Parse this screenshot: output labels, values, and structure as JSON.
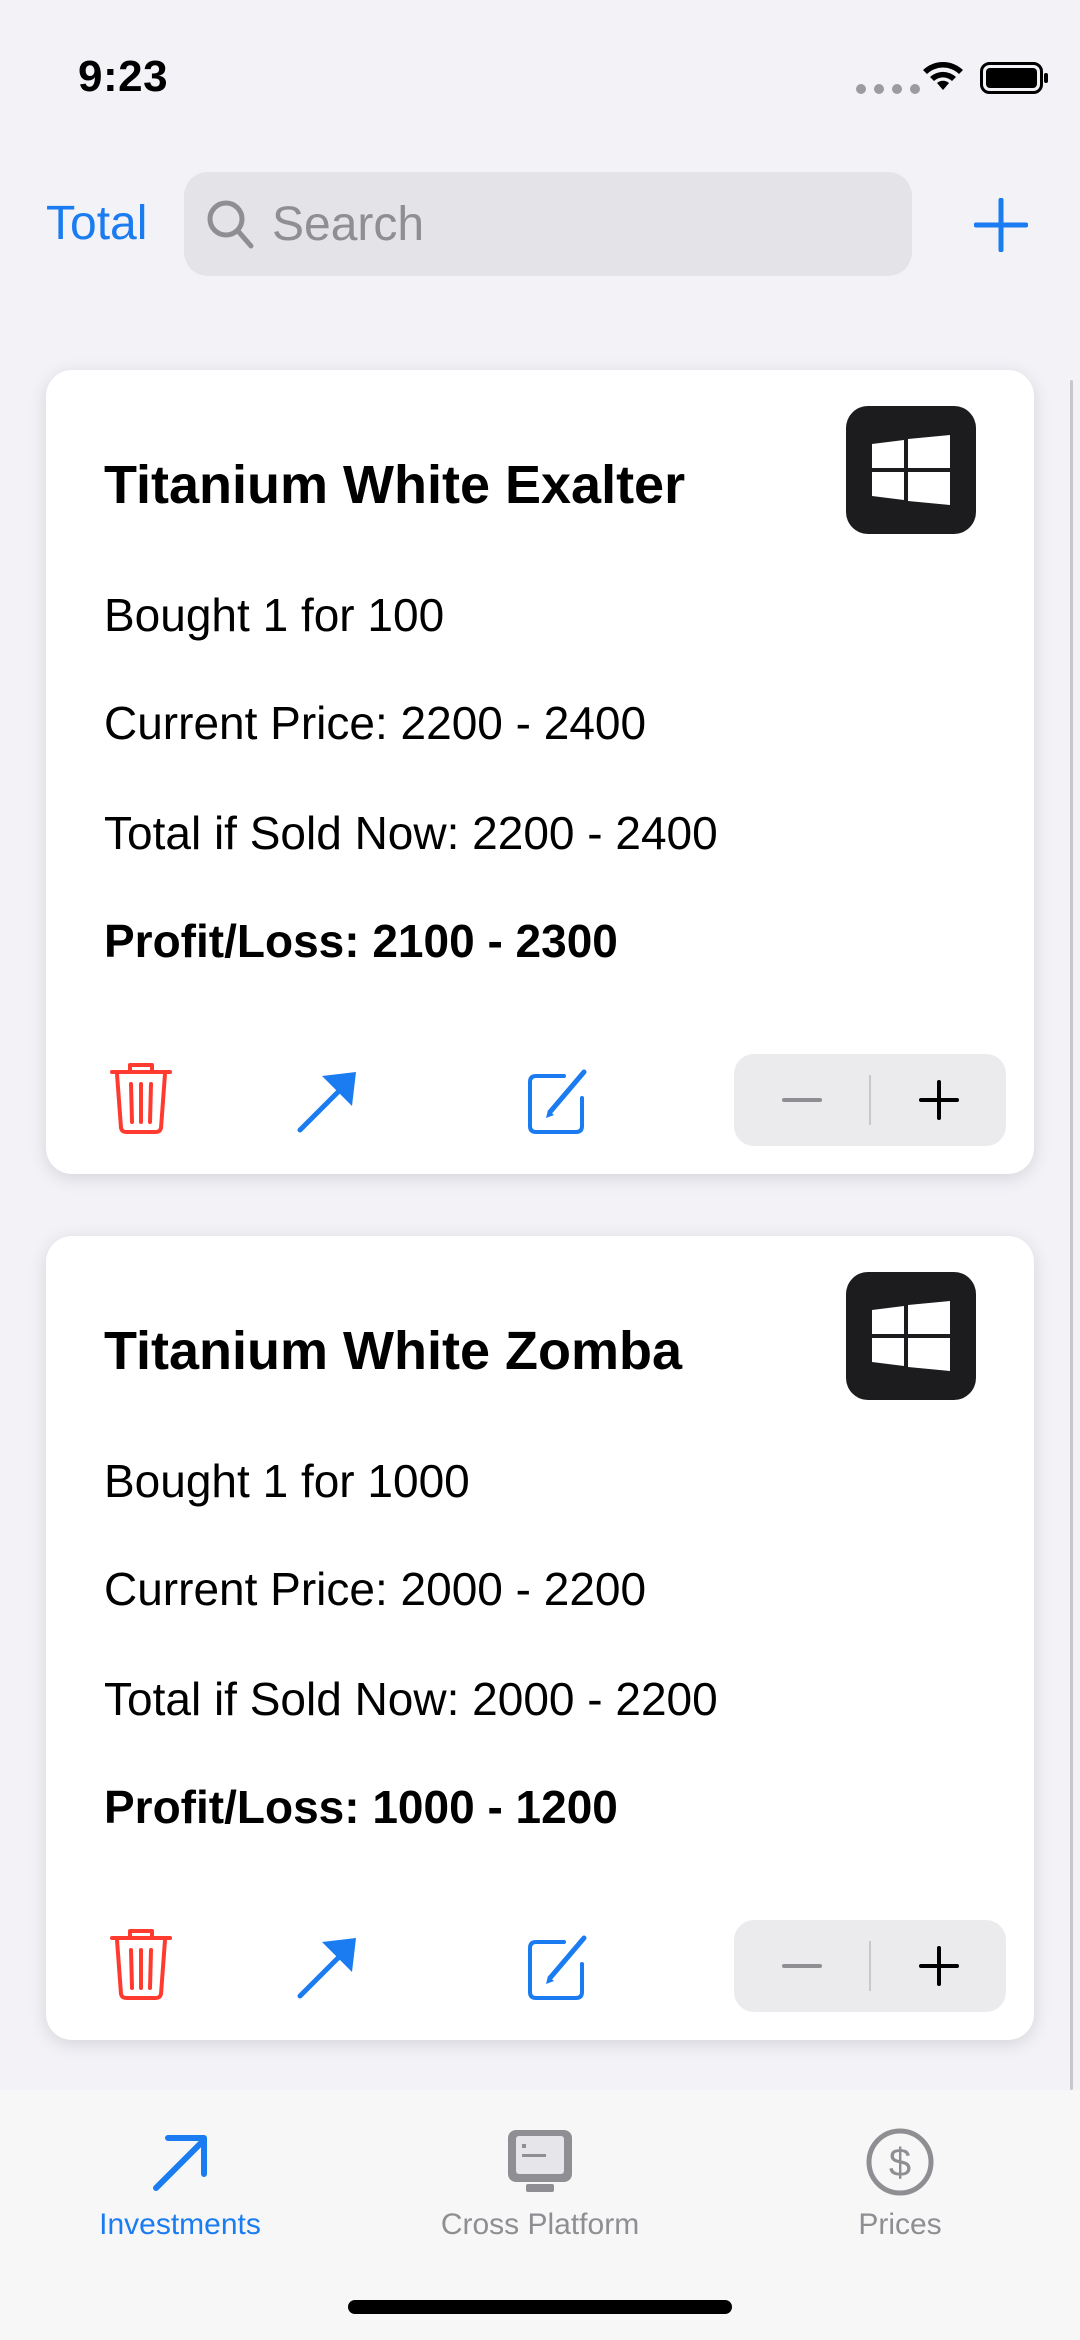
{
  "status": {
    "time": "9:23"
  },
  "header": {
    "total_label": "Total",
    "search_placeholder": "Search"
  },
  "investments": [
    {
      "title": "Titanium White Exalter",
      "bought": "Bought 1 for 100",
      "current_price": "Current Price: 2200 - 2400",
      "total_if_sold": "Total if Sold Now: 2200 - 2400",
      "profit_loss": "Profit/Loss: 2100 - 2300",
      "platform_icon": "windows-icon"
    },
    {
      "title": "Titanium White Zomba",
      "bought": "Bought 1 for 1000",
      "current_price": "Current Price: 2000 - 2200",
      "total_if_sold": "Total if Sold Now: 2000 - 2200",
      "profit_loss": "Profit/Loss: 1000 - 1200",
      "platform_icon": "windows-icon"
    }
  ],
  "tabs": [
    {
      "label": "Investments",
      "icon": "arrow-up-right-icon",
      "active": true
    },
    {
      "label": "Cross Platform",
      "icon": "desktop-computer-icon",
      "active": false
    },
    {
      "label": "Prices",
      "icon": "dollar-circle-icon",
      "active": false
    }
  ],
  "colors": {
    "accent": "#1a7cf0",
    "delete": "#ff3b30",
    "background": "#f2f2f7"
  }
}
